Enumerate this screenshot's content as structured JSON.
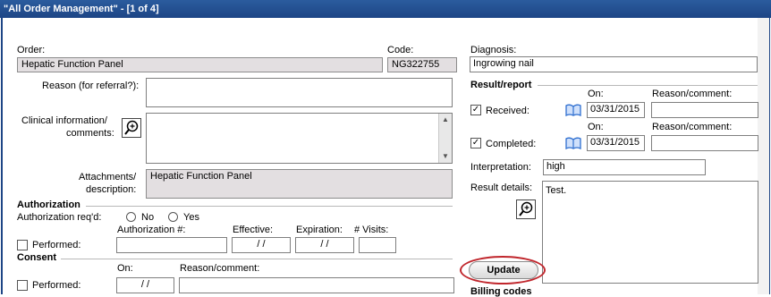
{
  "window": {
    "title": "\"All Order Management\" - [1 of 4]"
  },
  "order": {
    "order_label": "Order:",
    "order_value": "Hepatic Function Panel",
    "code_label": "Code:",
    "code_value": "NG322755",
    "reason_label": "Reason (for referral?):",
    "reason_value": "",
    "clinical_label_1": "Clinical information/",
    "clinical_label_2": "comments:",
    "clinical_value": "",
    "attach_label_1": "Attachments/",
    "attach_label_2": "description:",
    "attach_value": "Hepatic Function Panel"
  },
  "authorization": {
    "title": "Authorization",
    "req_label": "Authorization req'd:",
    "no_label": "No",
    "yes_label": "Yes",
    "number_label": "Authorization #:",
    "effective_label": "Effective:",
    "expiration_label": "Expiration:",
    "visits_label": "# Visits:",
    "performed_label": "Performed:",
    "number_value": "",
    "effective_value": "/ /",
    "expiration_value": "/ /",
    "visits_value": ""
  },
  "consent": {
    "title": "Consent",
    "on_label": "On:",
    "reason_label": "Reason/comment:",
    "performed_label": "Performed:",
    "on_value": "/ /",
    "reason_value": ""
  },
  "diagnosis": {
    "label": "Diagnosis:",
    "value": "Ingrowing nail"
  },
  "result": {
    "title": "Result/report",
    "on_label": "On:",
    "reason_label": "Reason/comment:",
    "received_label": "Received:",
    "received_checked": "✓",
    "received_date": "03/31/2015",
    "received_reason": "",
    "completed_label": "Completed:",
    "completed_checked": "✓",
    "completed_date": "03/31/2015",
    "completed_reason": "",
    "interpretation_label": "Interpretation:",
    "interpretation_value": "high",
    "details_label": "Result details:",
    "details_value": "Test."
  },
  "actions": {
    "update_label": "Update"
  },
  "billing": {
    "title": "Billing codes"
  },
  "icons": {
    "zoom": "magnifier-plus-icon",
    "book": "open-book-icon"
  },
  "colors": {
    "title_bar": "#1d4585",
    "readonly_bg": "#e3dfe1",
    "highlight_ring": "#c0262c",
    "book_blue": "#2f6fd0"
  }
}
